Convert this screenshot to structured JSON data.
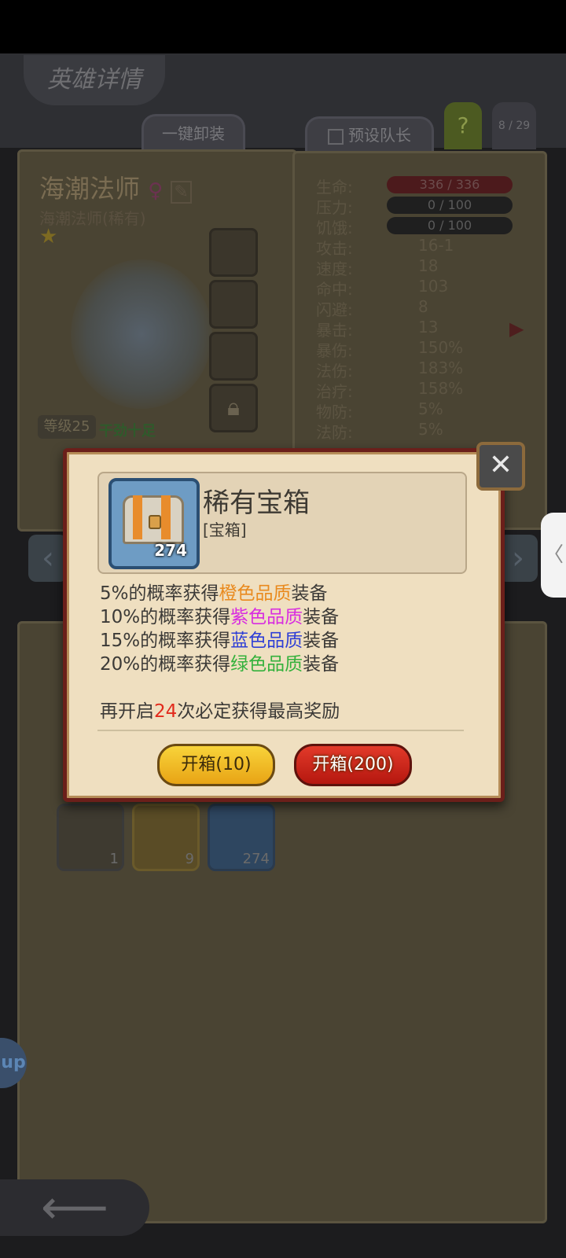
{
  "header": {
    "title": "英雄详情",
    "unequip_all": "一键卸装",
    "preset_captain": "预设队长",
    "help": "?",
    "page_counter": "8 / 29"
  },
  "hero": {
    "name": "海潮法师",
    "subtitle": "海潮法师(稀有)",
    "level": "等级25",
    "mood": "干劲十足"
  },
  "stats": {
    "life_label": "生命:",
    "life_value": "336 / 336",
    "stress_label": "压力:",
    "stress_value": "0 / 100",
    "hunger_label": "饥饿:",
    "hunger_value": "0 / 100",
    "rows": [
      {
        "label": "攻击:",
        "value": "16-1"
      },
      {
        "label": "速度:",
        "value": "18"
      },
      {
        "label": "命中:",
        "value": "103"
      },
      {
        "label": "闪避:",
        "value": "8"
      },
      {
        "label": "暴击:",
        "value": "13"
      },
      {
        "label": "暴伤:",
        "value": "150%"
      },
      {
        "label": "法伤:",
        "value": "183%"
      },
      {
        "label": "治疗:",
        "value": "158%"
      },
      {
        "label": "物防:",
        "value": "5%"
      },
      {
        "label": "法防:",
        "value": "5%"
      }
    ]
  },
  "inventory": [
    {
      "count": "1",
      "color": "#3e3a30"
    },
    {
      "count": "9",
      "color": "#6a5a2a"
    },
    {
      "count": "274",
      "color": "#2e4660"
    }
  ],
  "floating": {
    "app_badge": "up",
    "side_handle": "〈"
  },
  "dialog": {
    "item_name": "稀有宝箱",
    "item_type": "[宝箱]",
    "item_count": "274",
    "lines": [
      {
        "pre": "5%的概率获得",
        "hl": "橙色品质",
        "post": "装备"
      },
      {
        "pre": "10%的概率获得",
        "hl": "紫色品质",
        "post": "装备"
      },
      {
        "pre": "15%的概率获得",
        "hl": "蓝色品质",
        "post": "装备"
      },
      {
        "pre": "20%的概率获得",
        "hl": "绿色品质",
        "post": "装备"
      }
    ],
    "guarantee_pre": "再开启",
    "guarantee_num": "24",
    "guarantee_post": "次必定获得最高奖励",
    "btn_open_10": "开箱(10)",
    "btn_open_200": "开箱(200)"
  }
}
